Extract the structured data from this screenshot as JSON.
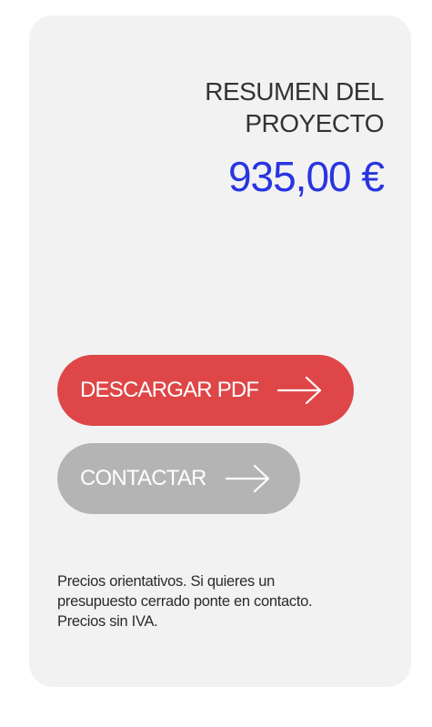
{
  "summary": {
    "title_line1": "RESUMEN DEL",
    "title_line2": "PROYECTO",
    "price": "935,00 €"
  },
  "actions": {
    "download_label": "DESCARGAR PDF",
    "contact_label": "CONTACTAR",
    "arrow_icon": "arrow-right-icon"
  },
  "note": {
    "line1": "Precios orientativos. Si quieres un",
    "line2": "presupuesto cerrado ponte en contacto.",
    "line3": "Precios sin IVA."
  },
  "colors": {
    "card_background": "#f2f2f3",
    "price": "#2835e0",
    "primary_button": "#de4647",
    "secondary_button": "#b4b4b4"
  }
}
